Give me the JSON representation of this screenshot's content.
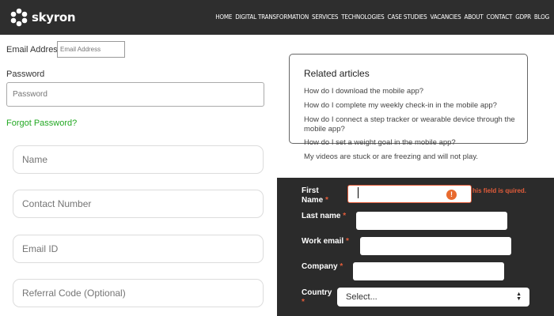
{
  "header": {
    "brand": "skyron",
    "nav": [
      "HOME",
      "DIGITAL TRANSFORMATION",
      "SERVICES",
      "TECHNOLOGIES",
      "CASE STUDIES",
      "VACANCIES",
      "ABOUT",
      "CONTACT",
      "GDPR",
      "BLOG"
    ]
  },
  "login": {
    "email_label": "Email Address",
    "email_placeholder": "Email Address",
    "password_label": "Password",
    "password_placeholder": "Password",
    "forgot_link": "Forgot Password?"
  },
  "contact_form": {
    "name_placeholder": "Name",
    "contact_placeholder": "Contact Number",
    "email_placeholder": "Email ID",
    "referral_placeholder": "Referral Code (Optional)"
  },
  "related": {
    "title": "Related articles",
    "articles": [
      "How do I download the mobile app?",
      "How do I complete my weekly check-in in the mobile app?",
      "How do I connect a step tracker or wearable device through the mobile app?",
      "How do I set a weight goal in the mobile app?",
      "My videos are stuck or are freezing and will not play."
    ]
  },
  "signup_form": {
    "first_name_label": "First Name",
    "last_name_label": "Last name",
    "work_email_label": "Work email",
    "company_label": "Company",
    "country_label": "Country",
    "required_mark": "*",
    "error_message": "his field is quired.",
    "country_select_value": "Select...",
    "colors": {
      "background": "#2b2b2b",
      "error": "#e25c3a"
    }
  }
}
